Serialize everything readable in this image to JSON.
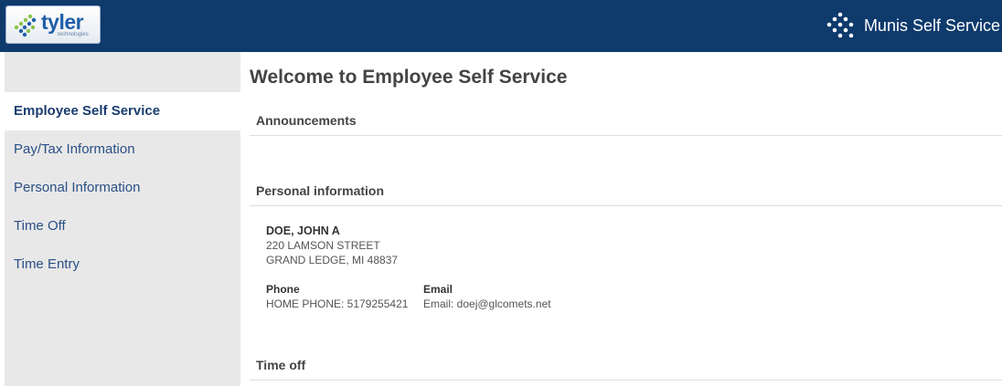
{
  "header": {
    "logo_text": "tyler",
    "logo_subtext": "technologies",
    "app_name": "Munis Self Service"
  },
  "sidebar": {
    "items": [
      {
        "label": "Employee Self Service",
        "active": true
      },
      {
        "label": "Pay/Tax Information",
        "active": false
      },
      {
        "label": "Personal Information",
        "active": false
      },
      {
        "label": "Time Off",
        "active": false
      },
      {
        "label": "Time Entry",
        "active": false
      }
    ]
  },
  "main": {
    "title": "Welcome to Employee Self Service",
    "sections": {
      "announcements": "Announcements",
      "personal_information": "Personal information",
      "time_off": "Time off"
    },
    "person": {
      "name": "DOE, JOHN A",
      "address_line1": "220 LAMSON STREET",
      "address_line2": "GRAND LEDGE, MI 48837",
      "phone_label": "Phone",
      "phone_value": "HOME PHONE: 5179255421",
      "email_label": "Email",
      "email_value": "Email: doej@glcomets.net"
    }
  },
  "colors": {
    "topbar": "#0e3a6c",
    "sidebar_bg": "#e8e8e8",
    "nav_link": "#2a4f86"
  },
  "icons": {
    "logo": "tyler-dots-icon",
    "brand": "munis-dots-icon"
  }
}
